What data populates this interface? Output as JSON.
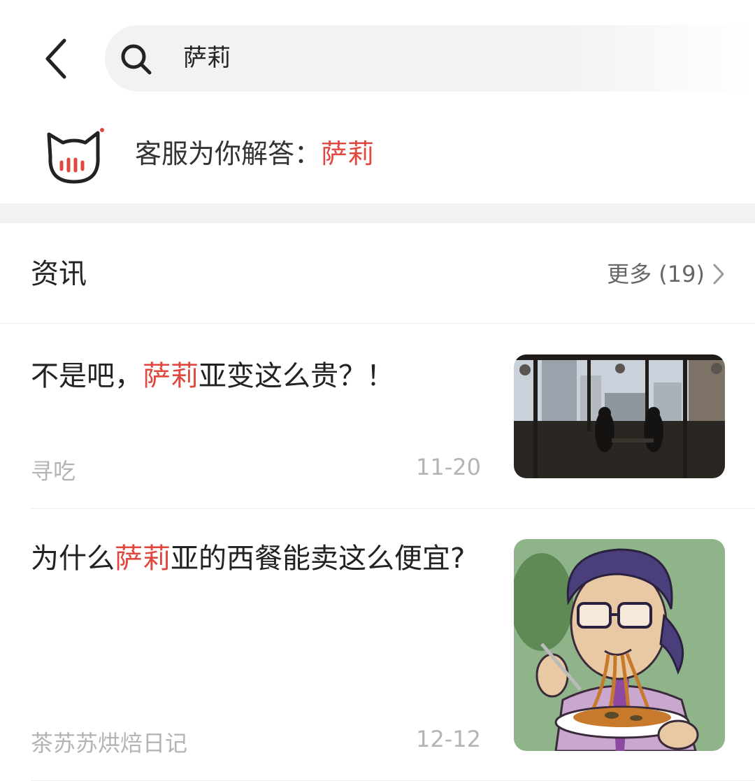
{
  "search": {
    "query": "萨莉"
  },
  "service": {
    "prefix": "客服为你解答：",
    "keyword": "萨莉"
  },
  "section": {
    "title": "资讯",
    "more_label": "更多 (19)"
  },
  "news": [
    {
      "title_before": "不是吧，",
      "title_highlight": "萨莉",
      "title_after": "亚变这么贵？！",
      "source": "寻吃",
      "date": "11-20",
      "thumb_icon": "restaurant-photo"
    },
    {
      "title_before": "为什么",
      "title_highlight": "萨莉",
      "title_after": "亚的西餐能卖这么便宜?",
      "source": "茶苏苏烘焙日记",
      "date": "12-12",
      "thumb_icon": "anime-man-eating-pasta"
    }
  ],
  "colors": {
    "highlight": "#e0473e",
    "search_bg": "#f2f2f4",
    "muted_text": "#b4b4b4"
  }
}
